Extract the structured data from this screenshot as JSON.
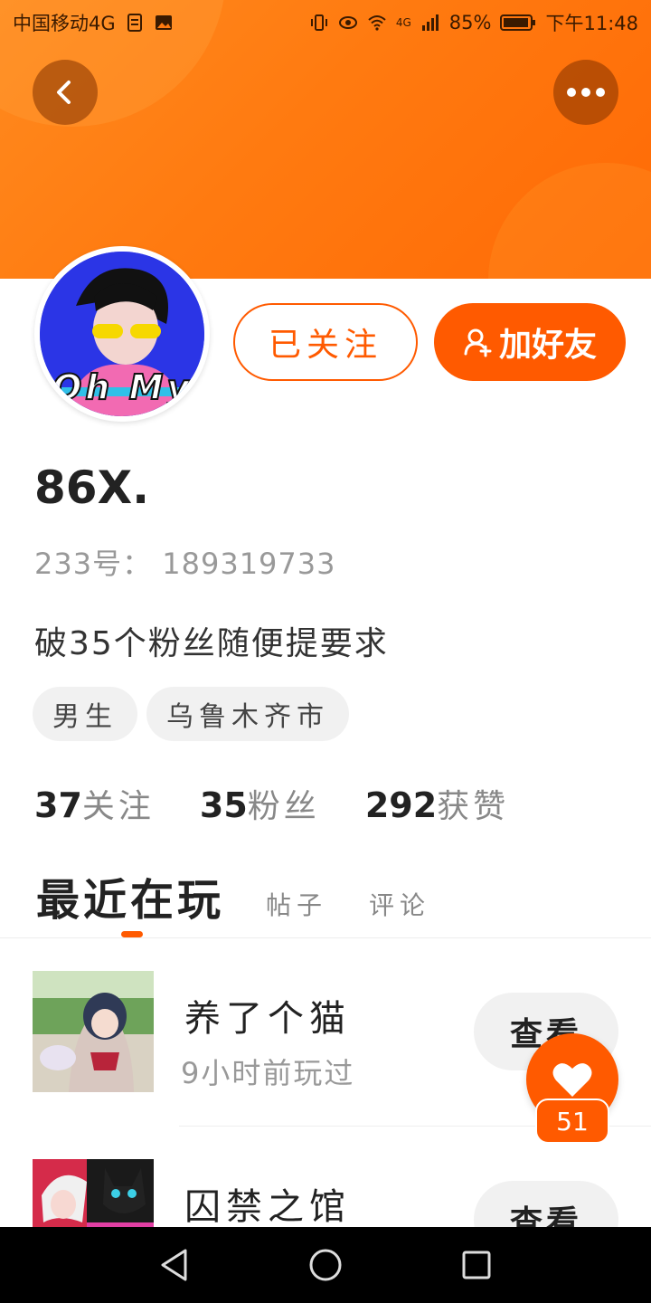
{
  "status_bar": {
    "carrier": "中国移动4G",
    "network": "4G",
    "battery": "85%",
    "time": "下午11:48"
  },
  "header": {
    "back_icon": "chevron-left-icon",
    "more_icon": "more-horizontal-icon",
    "color": "#ff7a10"
  },
  "avatar": {
    "text": "Oh My"
  },
  "actions": {
    "followed_label": "已关注",
    "add_friend_label": "加好友"
  },
  "profile": {
    "nickname": "86X.",
    "uid": "233号： 189319733",
    "bio": "破35个粉丝随便提要求",
    "tags": [
      "男生",
      "乌鲁木齐市"
    ]
  },
  "stats": [
    {
      "num": "37",
      "label": "关注"
    },
    {
      "num": "35",
      "label": "粉丝"
    },
    {
      "num": "292",
      "label": "获赞"
    }
  ],
  "tabs": {
    "active": "最近在玩",
    "items": [
      "帖子",
      "评论"
    ]
  },
  "games": [
    {
      "title": "养了个猫",
      "time": "9小时前玩过",
      "view_label": "查看"
    },
    {
      "title": "囚禁之馆",
      "time": "",
      "view_label": "查看"
    }
  ],
  "like": {
    "count": "51"
  },
  "accent_color": "#ff5a00"
}
